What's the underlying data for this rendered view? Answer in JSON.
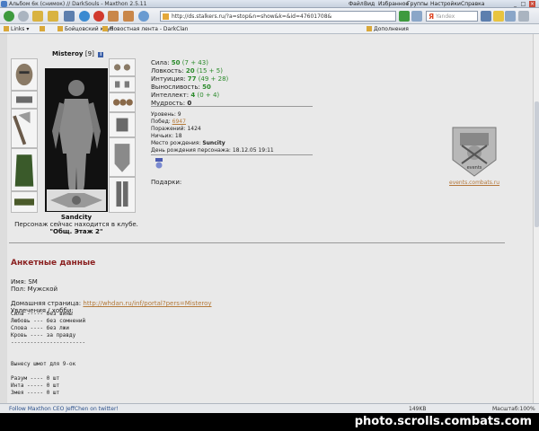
{
  "window": {
    "title": "Альбом 6к (снимок) // DarkSouls - Maxthon 2.5.11"
  },
  "menubar": [
    "Файл",
    "Вид",
    "Избранное",
    "Группы",
    "Настройки",
    "Справка"
  ],
  "address": {
    "url": "http://ds.stalkers.ru/?a=stop&n=show&k=&id=47601708&"
  },
  "search": {
    "placeholder": "Yandex",
    "engine": "Я"
  },
  "bookmarks": [
    {
      "label": "Links"
    },
    {
      "label": ""
    },
    {
      "label": "Бойцовский клуб"
    },
    {
      "label": "Новостная лента - DarkClan"
    },
    {
      "label": "Дополнения"
    }
  ],
  "character": {
    "name": "Misteroy",
    "level": "[9]",
    "info_icon": "i",
    "pet_name": "Sandcity",
    "location_text": "Персонаж сейчас находится в клубе.",
    "room": "\"Общ. Этаж 2\""
  },
  "stats": [
    {
      "label": "Сила:",
      "value": "50",
      "bonus": "(7 + 43)"
    },
    {
      "label": "Ловкость:",
      "value": "20",
      "bonus": "(15 + 5)"
    },
    {
      "label": "Интуиция:",
      "value": "77",
      "bonus": "(49 + 28)"
    },
    {
      "label": "Выносливость:",
      "value": "50",
      "bonus": ""
    },
    {
      "label": "Интеллект:",
      "value": "4",
      "bonus": "(0 + 4)"
    },
    {
      "label": "Мудрость:",
      "value": "0",
      "bonus": ""
    }
  ],
  "info": {
    "level_label": "Уровень:",
    "level": "9",
    "wins_label": "Побед:",
    "wins": "6947",
    "losses_label": "Поражений:",
    "losses": "1424",
    "draws_label": "Ничьих:",
    "draws": "18",
    "birthplace_label": "Место рождения:",
    "birthplace": "Suncity",
    "birthday_label": "День рождения персонажа:",
    "birthday": "18.12.05 19:11"
  },
  "gifts_label": "Подарки:",
  "clan": {
    "link": "events.combats.ru",
    "emblem_text": "events"
  },
  "profile": {
    "title": "Анкетные данные",
    "name_label": "Имя:",
    "name": "SM",
    "sex_label": "Пол:",
    "sex": "Мужской",
    "homepage_label": "Домашняя страница:",
    "homepage": "http://whdan.ru/inf/portal?pers=Misteroy",
    "hobby_label": "Увлечения / хобби:",
    "hobby_lines": [
      "Сила ----- без вины",
      "Любовь --- без сомнений",
      "Слова ---- без лжи",
      "Кровь ---- за правду",
      "-----------------------",
      "",
      "",
      "Вынесу шмот для 9-ок",
      "",
      "Разум ---- 0 шт",
      "Инта ----- 0 шт",
      "Змея ----- 0 шт"
    ]
  },
  "status": {
    "text": "Follow Maxthon CEO JeffChen on twitter!",
    "speed": "149KB",
    "mode": "Масштаб:100%"
  },
  "watermark": "photo.scrolls.combats.com",
  "colors": {
    "section_title": "#8a1f1f",
    "stat_value": "#2a8a2a",
    "link": "#b47a3a"
  }
}
